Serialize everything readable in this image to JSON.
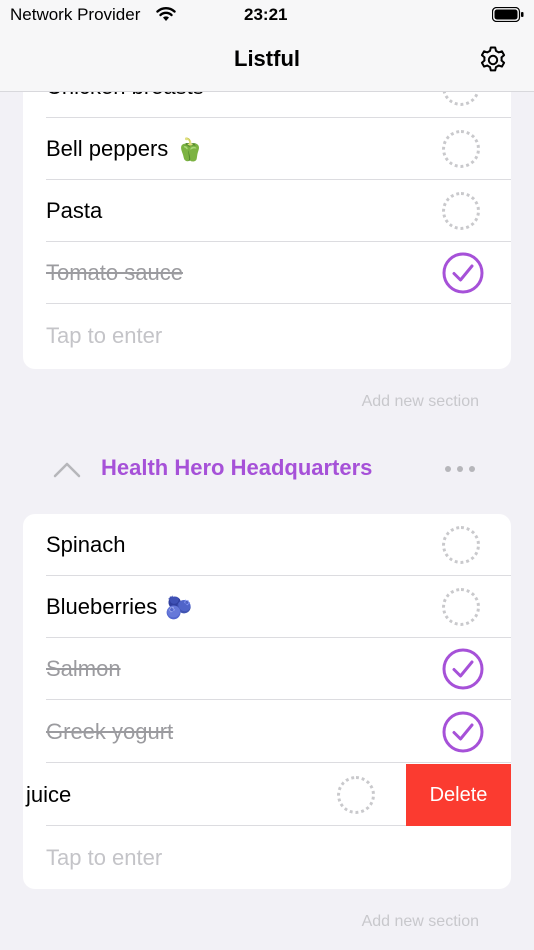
{
  "status_bar": {
    "carrier": "Network Provider",
    "time": "23:21"
  },
  "nav": {
    "title": "Listful",
    "settings_icon": "gear-icon"
  },
  "section1": {
    "items": [
      {
        "label": "Chicken breasts",
        "done": false
      },
      {
        "label": "Bell peppers",
        "emoji": "🫑",
        "done": false
      },
      {
        "label": "Pasta",
        "done": false
      },
      {
        "label": "Tomato sauce",
        "done": true
      }
    ],
    "placeholder": "Tap to enter",
    "add_section": "Add new section"
  },
  "section2": {
    "title": "Health Hero Headquarters",
    "title_color": "#a651d8",
    "items": [
      {
        "label": "Spinach",
        "done": false
      },
      {
        "label": "Blueberries",
        "emoji": "🫐",
        "done": false
      },
      {
        "label": "Salmon",
        "done": true
      },
      {
        "label": "Greek yogurt",
        "done": true
      },
      {
        "label": "juice",
        "done": false,
        "swiped": true
      }
    ],
    "delete_label": "Delete",
    "placeholder": "Tap to enter",
    "add_section": "Add new section"
  },
  "colors": {
    "accent": "#a651d8",
    "delete": "#fb3b30"
  }
}
